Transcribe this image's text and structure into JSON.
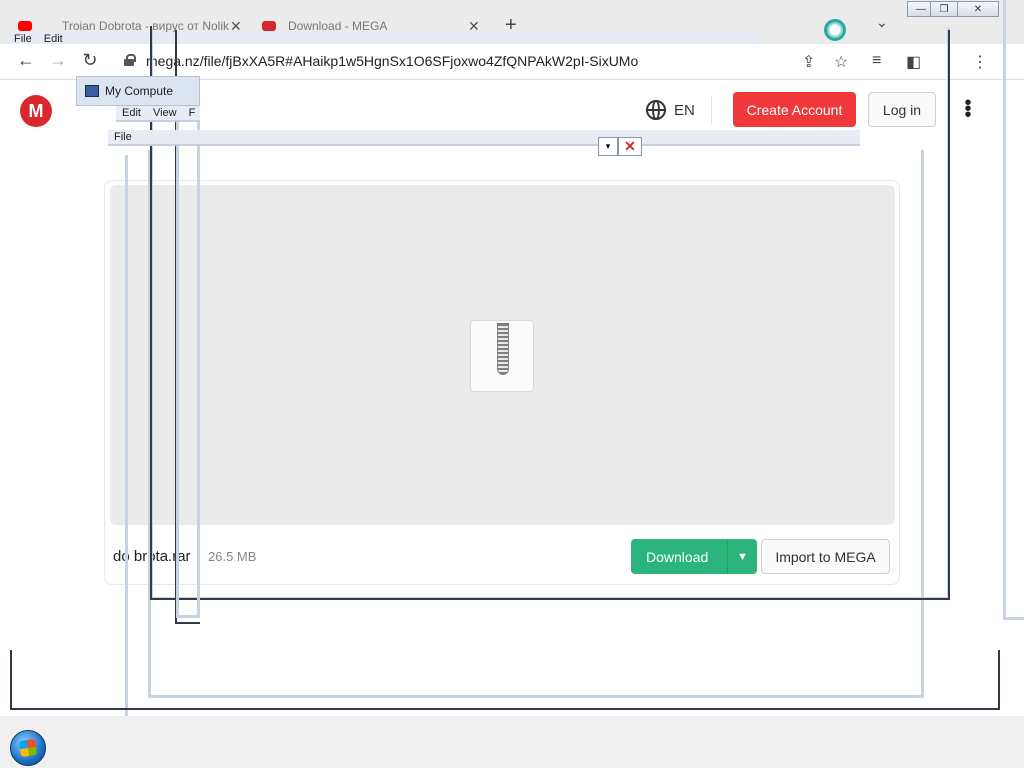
{
  "tabs": [
    {
      "title": "Troian Dobrota - вирус от Nolik",
      "favicon_color": "#ff0000"
    },
    {
      "title": "Download - MEGA",
      "favicon_color": "#d9272e"
    }
  ],
  "tab_icons": {
    "new_tab": "+",
    "close": "✕",
    "tab_search": "⌄"
  },
  "toolbar": {
    "url": "mega.nz/file/fjBxXA5R#AHaikp1w5HgnSx1O6SFjoxwo4ZfQNPAkW2pI-SixUMo",
    "back": "←",
    "forward": "→",
    "reload": "↻"
  },
  "menus": {
    "file": "File",
    "edit": "Edit",
    "view": "View",
    "f_truncated": "F"
  },
  "explorer": {
    "title": "My Compute"
  },
  "combo": {
    "arrow": "▾",
    "close": "✕"
  },
  "mega": {
    "logo": "M",
    "lang": "EN",
    "create_account": "Create Account",
    "login": "Log in",
    "more": "⋮",
    "file_name": "dobrota.rar",
    "file_name_visible": "do brota.rar",
    "file_size": "26.5 MB",
    "download": "Download",
    "download_menu": "▼",
    "import": "Import to MEGA"
  },
  "window_controls": {
    "minimize": "—",
    "maximize": "❐",
    "close": "✕"
  },
  "colors": {
    "mega_red": "#f0373a",
    "download_green": "#2bb57c"
  }
}
